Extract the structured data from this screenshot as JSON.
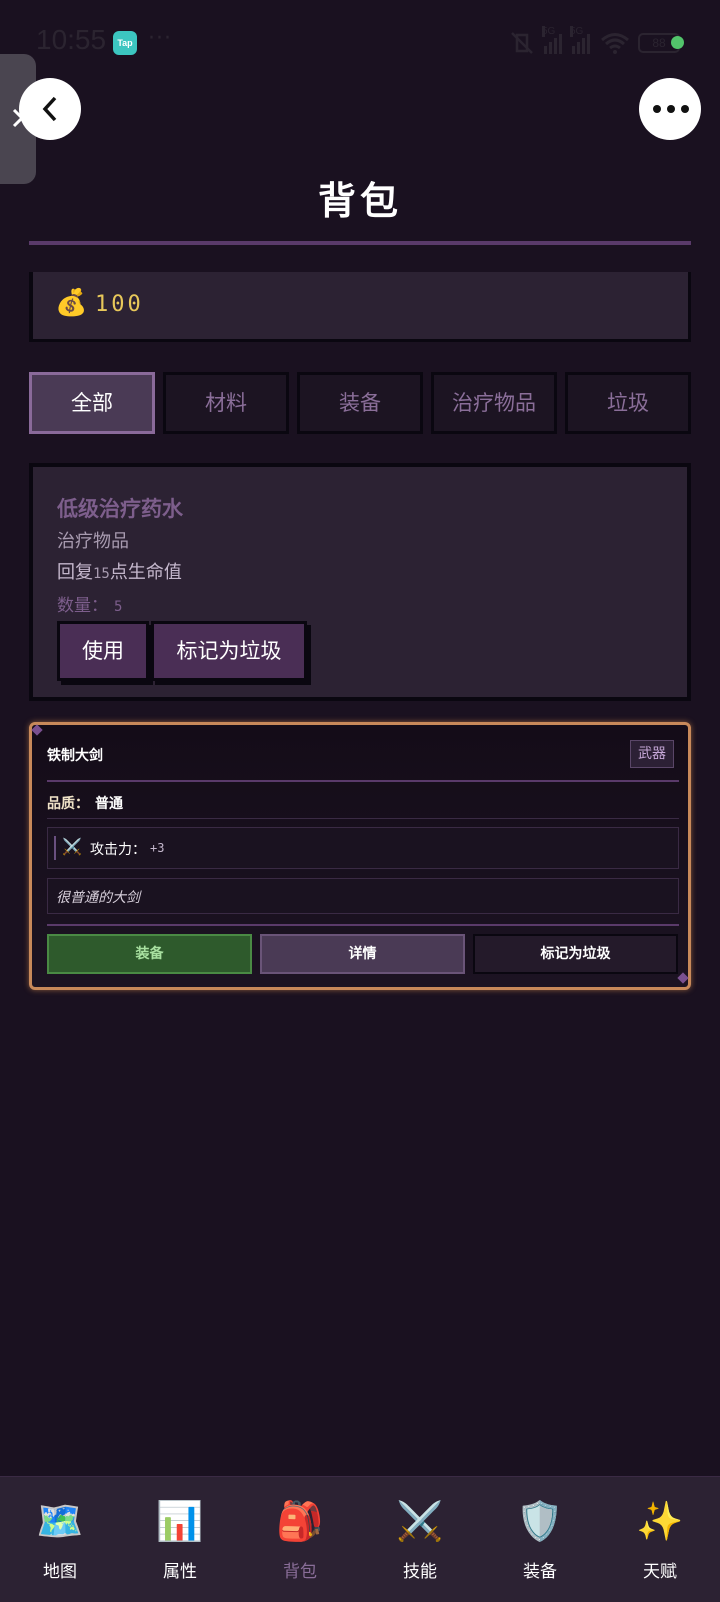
{
  "status_bar": {
    "time": "10:55",
    "app_badge": "Tap",
    "more": "···",
    "network_1": "5G",
    "network_2": "5G",
    "battery": "88"
  },
  "header": {
    "title": "背包"
  },
  "gold": {
    "icon": "money-bag-icon",
    "emoji": "💰",
    "value": "100"
  },
  "tabs": [
    {
      "label": "全部",
      "active": true
    },
    {
      "label": "材料",
      "active": false
    },
    {
      "label": "装备",
      "active": false
    },
    {
      "label": "治疗物品",
      "active": false
    },
    {
      "label": "垃圾",
      "active": false
    }
  ],
  "consumable_item": {
    "name": "低级治疗药水",
    "type": "治疗物品",
    "desc_prefix": "回复",
    "desc_value": "15",
    "desc_suffix": "点生命值",
    "qty_label": "数量：",
    "qty_value": "5",
    "use_button": "使用",
    "junk_button": "标记为垃圾"
  },
  "equipment_item": {
    "name": "铁制大剑",
    "tag": "武器",
    "quality_label": "品质：",
    "quality_value": "普通",
    "stat_icon": "crossed-swords-icon",
    "stat_emoji": "⚔️",
    "stat_label": "攻击力：",
    "stat_value": "+3",
    "description": "很普通的大剑",
    "equip_button": "装备",
    "detail_button": "详情",
    "junk_button": "标记为垃圾"
  },
  "bottom_nav": [
    {
      "label": "地图",
      "emoji": "🗺️",
      "icon": "map-icon",
      "active": false
    },
    {
      "label": "属性",
      "emoji": "📊",
      "icon": "bar-chart-icon",
      "active": false
    },
    {
      "label": "背包",
      "emoji": "🎒",
      "icon": "backpack-icon",
      "active": true
    },
    {
      "label": "技能",
      "emoji": "⚔️",
      "icon": "crossed-swords-icon",
      "active": false
    },
    {
      "label": "装备",
      "emoji": "🛡️",
      "icon": "shield-icon",
      "active": false
    },
    {
      "label": "天赋",
      "emoji": "✨",
      "icon": "sparkles-icon",
      "active": false
    }
  ],
  "colors": {
    "background": "#1a1120",
    "panel": "#2c2233",
    "accent_purple": "#8a6e99",
    "gold": "#e8c85a",
    "equip_border": "#c8895a",
    "equip_green": "#2e5a2c"
  }
}
